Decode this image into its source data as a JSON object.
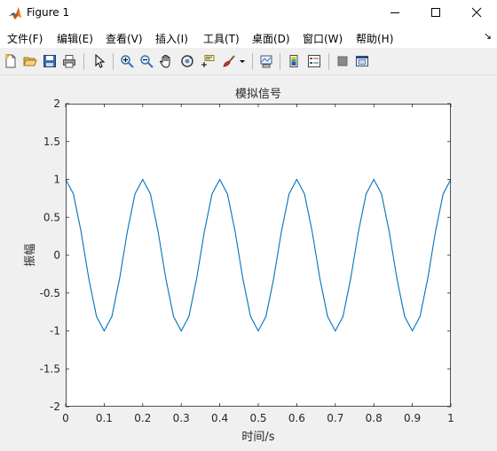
{
  "window": {
    "title": "Figure 1"
  },
  "menu": {
    "items": [
      "文件(F)",
      "编辑(E)",
      "查看(V)",
      "插入(I)",
      "工具(T)",
      "桌面(D)",
      "窗口(W)",
      "帮助(H)"
    ],
    "overflow": "↘"
  },
  "toolbar": {
    "icons": [
      "new-figure-icon",
      "open-file-icon",
      "save-icon",
      "print-icon",
      "pointer-icon",
      "zoom-in-icon",
      "zoom-out-icon",
      "pan-hand-icon",
      "rotate-3d-icon",
      "data-cursor-icon",
      "brush-icon",
      "brush-dropdown-icon",
      "link-plot-icon",
      "colorbar-icon",
      "legend-icon",
      "hide-plot-tools-icon",
      "show-plot-tools-icon"
    ]
  },
  "colors": {
    "line": "#0072bd",
    "axes_bg": "#ffffff",
    "figure_bg": "#f0f0f0"
  },
  "chart_data": {
    "type": "line",
    "title": "模拟信号",
    "xlabel": "时间/s",
    "ylabel": "振幅",
    "xlim": [
      0,
      1
    ],
    "ylim": [
      -2,
      2
    ],
    "xticks": [
      "0",
      "0.1",
      "0.2",
      "0.3",
      "0.4",
      "0.5",
      "0.6",
      "0.7",
      "0.8",
      "0.9",
      "1"
    ],
    "yticks": [
      "-2",
      "-1.5",
      "-1",
      "-0.5",
      "0",
      "0.5",
      "1",
      "1.5",
      "2"
    ],
    "grid": false,
    "series": [
      {
        "x": [
          0,
          0.02,
          0.04,
          0.06,
          0.08,
          0.1,
          0.12,
          0.14,
          0.16,
          0.18,
          0.2,
          0.22,
          0.24,
          0.26,
          0.28,
          0.3,
          0.32,
          0.34,
          0.36,
          0.38,
          0.4,
          0.42,
          0.44,
          0.46,
          0.48,
          0.5,
          0.52,
          0.54,
          0.56,
          0.58,
          0.6,
          0.62,
          0.64,
          0.66,
          0.68,
          0.7,
          0.72,
          0.74,
          0.76,
          0.78,
          0.8,
          0.82,
          0.84,
          0.86,
          0.88,
          0.9,
          0.92,
          0.94,
          0.96,
          0.98,
          1
        ],
        "y": [
          1,
          0.809,
          0.309,
          -0.309,
          -0.809,
          -1,
          -0.809,
          -0.309,
          0.309,
          0.809,
          1,
          0.809,
          0.309,
          -0.309,
          -0.809,
          -1,
          -0.809,
          -0.309,
          0.309,
          0.809,
          1,
          0.809,
          0.309,
          -0.309,
          -0.809,
          -1,
          -0.809,
          -0.309,
          0.309,
          0.809,
          1,
          0.809,
          0.309,
          -0.309,
          -0.809,
          -1,
          -0.809,
          -0.309,
          0.309,
          0.809,
          1,
          0.809,
          0.309,
          -0.309,
          -0.809,
          -1,
          -0.809,
          -0.309,
          0.309,
          0.809,
          1
        ]
      }
    ]
  }
}
